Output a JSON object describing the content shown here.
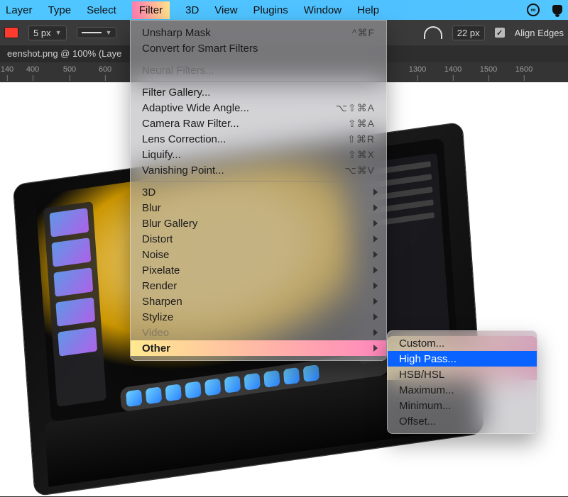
{
  "menubar": {
    "items": [
      "Layer",
      "Type",
      "Select",
      "Filter",
      "3D",
      "View",
      "Plugins",
      "Window",
      "Help"
    ],
    "highlight_index": 3
  },
  "toolbar": {
    "stroke_px": "5 px",
    "radius_px": "22 px",
    "align_edges_label": "Align Edges",
    "align_edges_checked": true
  },
  "document_tab": "eenshot.png @ 100% (Laye",
  "ruler_marks": [
    {
      "label": "140",
      "pos": 10
    },
    {
      "label": "400",
      "pos": 46
    },
    {
      "label": "500",
      "pos": 98
    },
    {
      "label": "600",
      "pos": 148
    },
    {
      "label": "1300",
      "pos": 588
    },
    {
      "label": "1400",
      "pos": 638
    },
    {
      "label": "1500",
      "pos": 688
    },
    {
      "label": "1600",
      "pos": 738
    }
  ],
  "filter_menu": [
    {
      "label": "Unsharp Mask",
      "shortcut": "^⌘F"
    },
    {
      "label": "Convert for Smart Filters"
    },
    {
      "sep": true
    },
    {
      "label": "Neural Filters...",
      "disabled": true
    },
    {
      "sep": true
    },
    {
      "label": "Filter Gallery..."
    },
    {
      "label": "Adaptive Wide Angle...",
      "shortcut": "⌥⇧⌘A"
    },
    {
      "label": "Camera Raw Filter...",
      "shortcut": "⇧⌘A"
    },
    {
      "label": "Lens Correction...",
      "shortcut": "⇧⌘R"
    },
    {
      "label": "Liquify...",
      "shortcut": "⇧⌘X"
    },
    {
      "label": "Vanishing Point...",
      "shortcut": "⌥⌘V"
    },
    {
      "sep": true
    },
    {
      "label": "3D",
      "submenu": true
    },
    {
      "label": "Blur",
      "submenu": true
    },
    {
      "label": "Blur Gallery",
      "submenu": true
    },
    {
      "label": "Distort",
      "submenu": true
    },
    {
      "label": "Noise",
      "submenu": true
    },
    {
      "label": "Pixelate",
      "submenu": true
    },
    {
      "label": "Render",
      "submenu": true
    },
    {
      "label": "Sharpen",
      "submenu": true
    },
    {
      "label": "Stylize",
      "submenu": true
    },
    {
      "label": "Video",
      "submenu": true,
      "disabled": true
    },
    {
      "label": "Other",
      "submenu": true,
      "highlight": true
    }
  ],
  "other_submenu": {
    "items": [
      "Custom...",
      "High Pass...",
      "HSB/HSL",
      "Maximum...",
      "Minimum...",
      "Offset..."
    ],
    "selected_index": 1
  }
}
